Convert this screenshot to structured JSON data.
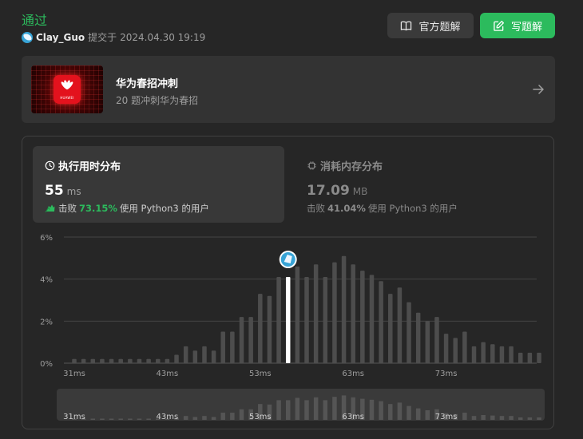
{
  "header": {
    "status": "通过",
    "username": "Clay_Guo",
    "submitted_label": "提交于",
    "timestamp": "2024.04.30 19:19"
  },
  "buttons": {
    "official_label": "官方题解",
    "write_label": "写题解"
  },
  "promo": {
    "title": "华为春招冲刺",
    "subtitle": "20 题冲刺华为春招",
    "thumb_logo_text": "HUAWEI"
  },
  "runtime": {
    "tab_label": "执行用时分布",
    "value": "55",
    "unit": "ms",
    "beats_label": "击败",
    "beats_pct": "73.15%",
    "beats_suffix": "使用 Python3 的用户"
  },
  "memory": {
    "tab_label": "消耗内存分布",
    "value": "17.09",
    "unit": "MB",
    "beats_label": "击败",
    "beats_pct": "41.04%",
    "beats_suffix": "使用 Python3 的用户"
  },
  "colors": {
    "accent_green": "#2cbb5d",
    "bar": "#4d4d4d",
    "highlight_bar": "#ffffff"
  },
  "chart_data": {
    "type": "bar",
    "title": "",
    "xlabel": "",
    "ylabel": "",
    "ylim": [
      0,
      6
    ],
    "y_ticks": [
      "0%",
      "2%",
      "4%",
      "6%"
    ],
    "y_tick_values": [
      0,
      2,
      4,
      6
    ],
    "x_ticks": [
      "31ms",
      "43ms",
      "53ms",
      "63ms",
      "73ms"
    ],
    "x_tick_indices": [
      0,
      10,
      20,
      30,
      40
    ],
    "values": [
      0.2,
      0.2,
      0.2,
      0.2,
      0.2,
      0.2,
      0.2,
      0.2,
      0.2,
      0.2,
      0.2,
      0.4,
      0.8,
      0.6,
      0.8,
      0.6,
      1.5,
      1.5,
      2.2,
      2.2,
      3.3,
      3.2,
      4.1,
      4.1,
      4.6,
      4.1,
      4.7,
      4.1,
      4.8,
      5.1,
      4.7,
      4.4,
      4.2,
      3.9,
      3.3,
      3.6,
      2.9,
      2.4,
      2.0,
      2.2,
      1.4,
      1.2,
      1.5,
      0.8,
      1.0,
      0.9,
      0.8,
      0.8,
      0.5,
      0.5,
      0.5
    ],
    "highlight_index": 23,
    "grid": true,
    "legend": "none"
  }
}
